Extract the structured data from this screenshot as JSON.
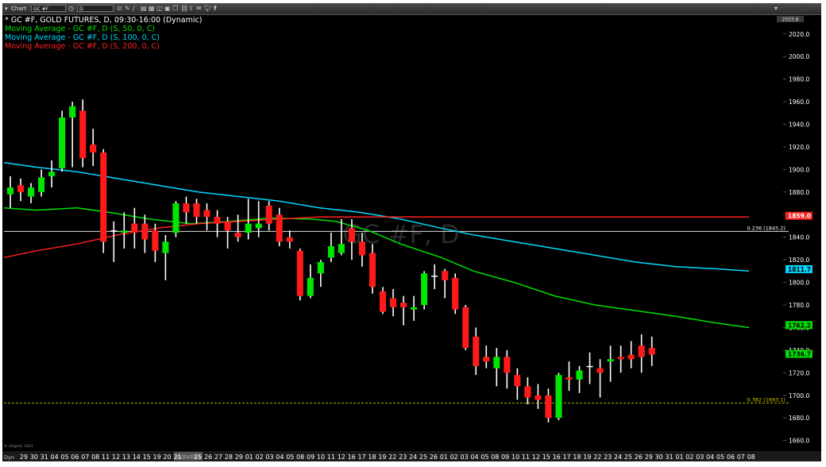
{
  "toolbar": {
    "chart_label": "Chart",
    "symbol": "GC #F",
    "interval": "D",
    "icons": [
      "clock-icon",
      "pencil-icon",
      "line-tool-icon",
      "chart-icon",
      "table-icon",
      "cube-icon",
      "link-icon",
      "copy-icon",
      "share-icon",
      "email-icon",
      "twitter-icon",
      "facebook-icon"
    ],
    "top_right_price": "2033.8"
  },
  "legend": {
    "title": "* GC #F, GOLD FUTURES, D, 09:30-16:00 (Dynamic)",
    "ma50": "Moving Average - GC #F, D (S, 50, 0, C)",
    "ma100": "Moving Average - GC #F, D (S, 100, 0, C)",
    "ma200": "Moving Average - GC #F, D (S, 200, 0, C)"
  },
  "watermark": "GC #F, D",
  "footer": {
    "copyright": "© eSignal, 2021",
    "left_label": "Dyn",
    "highlight_date": "01/21/2021"
  },
  "colors": {
    "background": "#000000",
    "up": "#00e600",
    "down": "#ff1a1a",
    "neutral": "#ffffff",
    "ma50": "#00e000",
    "ma100": "#00d8ff",
    "ma200": "#ff2020",
    "fib": "#c8c800",
    "axis_text": "#ffffff"
  },
  "chart_data": {
    "type": "candlestick",
    "symbol": "GC #F",
    "title": "GC #F, GOLD FUTURES, D, 09:30-16:00 (Dynamic)",
    "ylim": [
      1652,
      2036
    ],
    "yticks": [
      1660.0,
      1680.0,
      1700.0,
      1720.0,
      1740.0,
      1760.0,
      1780.0,
      1800.0,
      1820.0,
      1840.0,
      1860.0,
      1880.0,
      1900.0,
      1920.0,
      1940.0,
      1960.0,
      1980.0,
      2000.0,
      2020.0
    ],
    "x_labels": [
      "29",
      "30",
      "31",
      "04",
      "05",
      "06",
      "07",
      "08",
      "11",
      "12",
      "13",
      "14",
      "15",
      "19",
      "20",
      "21",
      "22",
      "25",
      "26",
      "27",
      "28",
      "29",
      "01",
      "02",
      "03",
      "04",
      "05",
      "08",
      "09",
      "10",
      "11",
      "12",
      "16",
      "17",
      "18",
      "19",
      "22",
      "23",
      "24",
      "25",
      "26",
      "01",
      "02",
      "03",
      "04",
      "05",
      "08",
      "09",
      "10",
      "11",
      "12",
      "15",
      "16",
      "17",
      "18",
      "19",
      "22",
      "23",
      "24",
      "25",
      "26",
      "29",
      "30",
      "31",
      "01",
      "02",
      "03",
      "04",
      "05",
      "06",
      "07",
      "08"
    ],
    "candles": [
      {
        "o": 1878,
        "h": 1894,
        "l": 1866,
        "c": 1884
      },
      {
        "o": 1886,
        "h": 1892,
        "l": 1872,
        "c": 1880
      },
      {
        "o": 1876,
        "h": 1888,
        "l": 1870,
        "c": 1884
      },
      {
        "o": 1880,
        "h": 1900,
        "l": 1876,
        "c": 1893
      },
      {
        "o": 1894,
        "h": 1908,
        "l": 1884,
        "c": 1898
      },
      {
        "o": 1901,
        "h": 1952,
        "l": 1898,
        "c": 1946
      },
      {
        "o": 1946,
        "h": 1960,
        "l": 1902,
        "c": 1956
      },
      {
        "o": 1952,
        "h": 1962,
        "l": 1902,
        "c": 1910
      },
      {
        "o": 1922,
        "h": 1936,
        "l": 1903,
        "c": 1915
      },
      {
        "o": 1915,
        "h": 1918,
        "l": 1826,
        "c": 1836
      },
      {
        "o": 1846,
        "h": 1854,
        "l": 1818,
        "c": 1846
      },
      {
        "o": 1844,
        "h": 1862,
        "l": 1830,
        "c": 1846
      },
      {
        "o": 1852,
        "h": 1866,
        "l": 1830,
        "c": 1844
      },
      {
        "o": 1852,
        "h": 1860,
        "l": 1826,
        "c": 1838
      },
      {
        "o": 1846,
        "h": 1852,
        "l": 1818,
        "c": 1828
      },
      {
        "o": 1826,
        "h": 1842,
        "l": 1802,
        "c": 1836
      },
      {
        "o": 1844,
        "h": 1872,
        "l": 1840,
        "c": 1870
      },
      {
        "o": 1870,
        "h": 1876,
        "l": 1852,
        "c": 1862
      },
      {
        "o": 1870,
        "h": 1874,
        "l": 1852,
        "c": 1858
      },
      {
        "o": 1864,
        "h": 1870,
        "l": 1846,
        "c": 1858
      },
      {
        "o": 1858,
        "h": 1864,
        "l": 1840,
        "c": 1852
      },
      {
        "o": 1854,
        "h": 1858,
        "l": 1830,
        "c": 1846
      },
      {
        "o": 1844,
        "h": 1860,
        "l": 1836,
        "c": 1840
      },
      {
        "o": 1844,
        "h": 1874,
        "l": 1838,
        "c": 1852
      },
      {
        "o": 1848,
        "h": 1872,
        "l": 1840,
        "c": 1852
      },
      {
        "o": 1868,
        "h": 1872,
        "l": 1846,
        "c": 1852
      },
      {
        "o": 1860,
        "h": 1866,
        "l": 1832,
        "c": 1836
      },
      {
        "o": 1840,
        "h": 1846,
        "l": 1830,
        "c": 1836
      },
      {
        "o": 1828,
        "h": 1830,
        "l": 1784,
        "c": 1788
      },
      {
        "o": 1788,
        "h": 1816,
        "l": 1786,
        "c": 1804
      },
      {
        "o": 1808,
        "h": 1820,
        "l": 1796,
        "c": 1818
      },
      {
        "o": 1822,
        "h": 1844,
        "l": 1818,
        "c": 1832
      },
      {
        "o": 1826,
        "h": 1856,
        "l": 1824,
        "c": 1834
      },
      {
        "o": 1848,
        "h": 1856,
        "l": 1820,
        "c": 1836
      },
      {
        "o": 1836,
        "h": 1844,
        "l": 1814,
        "c": 1824
      },
      {
        "o": 1826,
        "h": 1834,
        "l": 1790,
        "c": 1796
      },
      {
        "o": 1792,
        "h": 1796,
        "l": 1772,
        "c": 1774
      },
      {
        "o": 1786,
        "h": 1794,
        "l": 1770,
        "c": 1778
      },
      {
        "o": 1782,
        "h": 1788,
        "l": 1762,
        "c": 1778
      },
      {
        "o": 1776,
        "h": 1788,
        "l": 1766,
        "c": 1778
      },
      {
        "o": 1780,
        "h": 1810,
        "l": 1776,
        "c": 1808
      },
      {
        "o": 1806,
        "h": 1816,
        "l": 1794,
        "c": 1806
      },
      {
        "o": 1810,
        "h": 1812,
        "l": 1786,
        "c": 1802
      },
      {
        "o": 1804,
        "h": 1808,
        "l": 1772,
        "c": 1776
      },
      {
        "o": 1778,
        "h": 1780,
        "l": 1740,
        "c": 1742
      },
      {
        "o": 1752,
        "h": 1760,
        "l": 1718,
        "c": 1726
      },
      {
        "o": 1734,
        "h": 1744,
        "l": 1724,
        "c": 1730
      },
      {
        "o": 1724,
        "h": 1742,
        "l": 1708,
        "c": 1734
      },
      {
        "o": 1734,
        "h": 1740,
        "l": 1706,
        "c": 1720
      },
      {
        "o": 1718,
        "h": 1724,
        "l": 1696,
        "c": 1708
      },
      {
        "o": 1708,
        "h": 1716,
        "l": 1692,
        "c": 1698
      },
      {
        "o": 1700,
        "h": 1710,
        "l": 1688,
        "c": 1696
      },
      {
        "o": 1700,
        "h": 1706,
        "l": 1676,
        "c": 1680
      },
      {
        "o": 1680,
        "h": 1720,
        "l": 1678,
        "c": 1718
      },
      {
        "o": 1716,
        "h": 1730,
        "l": 1704,
        "c": 1714
      },
      {
        "o": 1714,
        "h": 1726,
        "l": 1702,
        "c": 1722
      },
      {
        "o": 1726,
        "h": 1738,
        "l": 1710,
        "c": 1726
      },
      {
        "o": 1724,
        "h": 1732,
        "l": 1698,
        "c": 1720
      },
      {
        "o": 1730,
        "h": 1744,
        "l": 1712,
        "c": 1732
      },
      {
        "o": 1734,
        "h": 1744,
        "l": 1720,
        "c": 1732
      },
      {
        "o": 1736,
        "h": 1748,
        "l": 1724,
        "c": 1732
      },
      {
        "o": 1744,
        "h": 1754,
        "l": 1720,
        "c": 1734
      },
      {
        "o": 1742,
        "h": 1752,
        "l": 1726,
        "c": 1736
      }
    ],
    "moving_averages": [
      {
        "name": "MA 50",
        "key": "ma50",
        "points": [
          [
            0,
            1866
          ],
          [
            4,
            1864
          ],
          [
            9,
            1866
          ],
          [
            13,
            1862
          ],
          [
            18,
            1856
          ],
          [
            23,
            1852
          ],
          [
            28,
            1854
          ],
          [
            33,
            1857
          ],
          [
            38,
            1856
          ],
          [
            41,
            1854
          ],
          [
            45,
            1846
          ],
          [
            49,
            1834
          ],
          [
            54,
            1822
          ],
          [
            58,
            1810
          ],
          [
            63,
            1800
          ],
          [
            68,
            1788
          ],
          [
            73,
            1780
          ],
          [
            78,
            1775
          ],
          [
            83,
            1770
          ],
          [
            88,
            1764
          ],
          [
            92,
            1760
          ]
        ]
      },
      {
        "name": "MA 100",
        "key": "ma100",
        "points": [
          [
            0,
            1906
          ],
          [
            4,
            1902
          ],
          [
            9,
            1898
          ],
          [
            14,
            1892
          ],
          [
            19,
            1886
          ],
          [
            24,
            1880
          ],
          [
            29,
            1876
          ],
          [
            34,
            1872
          ],
          [
            39,
            1866
          ],
          [
            44,
            1862
          ],
          [
            49,
            1856
          ],
          [
            54,
            1848
          ],
          [
            58,
            1842
          ],
          [
            63,
            1836
          ],
          [
            68,
            1830
          ],
          [
            73,
            1824
          ],
          [
            78,
            1818
          ],
          [
            83,
            1814
          ],
          [
            88,
            1812
          ],
          [
            92,
            1810
          ]
        ]
      },
      {
        "name": "MA 200",
        "key": "ma200",
        "points": [
          [
            0,
            1822
          ],
          [
            4,
            1828
          ],
          [
            9,
            1834
          ],
          [
            14,
            1842
          ],
          [
            19,
            1848
          ],
          [
            24,
            1852
          ],
          [
            29,
            1854
          ],
          [
            34,
            1856
          ],
          [
            39,
            1858
          ],
          [
            44,
            1858
          ],
          [
            49,
            1858
          ],
          [
            54,
            1858
          ],
          [
            58,
            1858
          ],
          [
            63,
            1858
          ],
          [
            68,
            1858
          ],
          [
            73,
            1858
          ],
          [
            78,
            1858
          ],
          [
            83,
            1858
          ],
          [
            88,
            1858
          ],
          [
            92,
            1858
          ]
        ]
      }
    ],
    "ma_x_scale": 92,
    "fib_levels": [
      {
        "label": "0.236 (1845.2)",
        "value": 1845.2,
        "color": "#ffffff"
      },
      {
        "label": "0.382 (1693.1)",
        "value": 1693.1,
        "color": "#c8c800"
      }
    ],
    "price_tags": [
      {
        "label": "1859.0",
        "value": 1859.0,
        "bg": "#ff2020",
        "fg": "#ffffff"
      },
      {
        "label": "1811.7",
        "value": 1811.7,
        "bg": "#00d8ff",
        "fg": "#000000"
      },
      {
        "label": "1762.2",
        "value": 1762.2,
        "bg": "#00e000",
        "fg": "#000000"
      },
      {
        "label": "1736.7",
        "value": 1736.7,
        "bg": "#00e000",
        "fg": "#000000"
      }
    ],
    "grid": false,
    "legend_position": "top-left"
  }
}
